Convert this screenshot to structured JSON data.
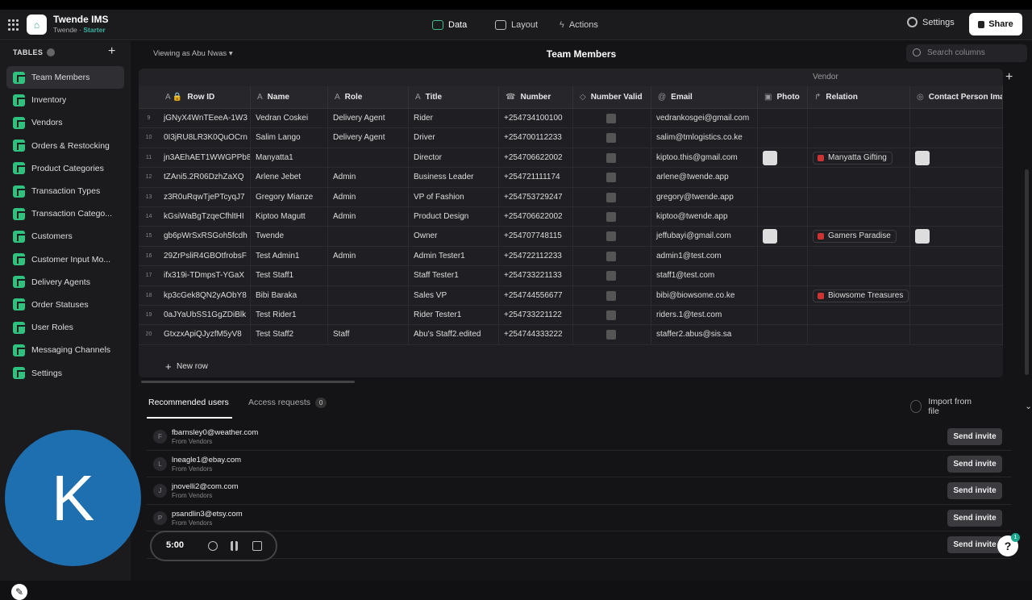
{
  "app": {
    "title": "Twende IMS",
    "workspace": "Twende",
    "plan": "Starter"
  },
  "nav": {
    "data": "Data",
    "layout": "Layout",
    "actions": "Actions",
    "settings": "Settings",
    "share": "Share"
  },
  "sidebar": {
    "header": "TABLES",
    "items": [
      "Team Members",
      "Inventory",
      "Vendors",
      "Orders & Restocking",
      "Product Categories",
      "Transaction Types",
      "Transaction Catego...",
      "Customers",
      "Customer Input Mo...",
      "Delivery Agents",
      "Order Statuses",
      "User Roles",
      "Messaging Channels",
      "Settings"
    ]
  },
  "main": {
    "viewing_as": "Viewing as Abu Nwas",
    "title": "Team Members",
    "search_placeholder": "Search columns",
    "group_label": "Vendor",
    "columns": [
      "Row ID",
      "Name",
      "Role",
      "Title",
      "Number",
      "Number Valid",
      "Email",
      "Photo",
      "Relation",
      "Contact Person Ima"
    ],
    "rows": [
      {
        "n": "9",
        "id": "jGNyX4WnTEeeA-1W3",
        "name": "Vedran Coskei",
        "role": "Delivery Agent",
        "title": "Rider",
        "number": "+254734100100",
        "email": "vedrankosgei@gmail.com",
        "photo": false,
        "relation": "",
        "contact": false
      },
      {
        "n": "10",
        "id": "0I3jRU8LR3K0QuOCrn",
        "name": "Salim Lango",
        "role": "Delivery Agent",
        "title": "Driver",
        "number": "+254700112233",
        "email": "salim@tmlogistics.co.ke",
        "photo": false,
        "relation": "",
        "contact": false
      },
      {
        "n": "11",
        "id": "jn3AEhAET1WWGPPb8",
        "name": "Manyatta1",
        "role": "",
        "title": "Director",
        "number": "+254706622002",
        "email": "kiptoo.this@gmail.com",
        "photo": true,
        "relation": "Manyatta Gifting",
        "contact": true
      },
      {
        "n": "12",
        "id": "tZAni5.2R06DzhZaXQ",
        "name": "Arlene Jebet",
        "role": "Admin",
        "title": "Business Leader",
        "number": "+254721111174",
        "email": "arlene@twende.app",
        "photo": false,
        "relation": "",
        "contact": false
      },
      {
        "n": "13",
        "id": "z3R0uRqwTjePTcyqJ7",
        "name": "Gregory Mianze",
        "role": "Admin",
        "title": "VP of Fashion",
        "number": "+254753729247",
        "email": "gregory@twende.app",
        "photo": false,
        "relation": "",
        "contact": false
      },
      {
        "n": "14",
        "id": "kGsiWaBgTzqeCfhltHI",
        "name": "Kiptoo Magutt",
        "role": "Admin",
        "title": "Product Design",
        "number": "+254706622002",
        "email": "kiptoo@twende.app",
        "photo": false,
        "relation": "",
        "contact": false
      },
      {
        "n": "15",
        "id": "gb6pWrSxRSGoh5fcdh",
        "name": "Twende",
        "role": "",
        "title": "Owner",
        "number": "+254707748115",
        "email": "jeffubayi@gmail.com",
        "photo": true,
        "relation": "Gamers Paradise",
        "contact": true
      },
      {
        "n": "16",
        "id": "29ZrPsliR4GBOtfrobsF",
        "name": "Test Admin1",
        "role": "Admin",
        "title": "Admin Tester1",
        "number": "+254722112233",
        "email": "admin1@test.com",
        "photo": false,
        "relation": "",
        "contact": false
      },
      {
        "n": "17",
        "id": "ifx319i-TDmpsT-YGaX",
        "name": "Test Staff1",
        "role": "",
        "title": "Staff Tester1",
        "number": "+254733221133",
        "email": "staff1@test.com",
        "photo": false,
        "relation": "",
        "contact": false
      },
      {
        "n": "18",
        "id": "kp3cGek8QN2yAObY8",
        "name": "Bibi Baraka",
        "role": "",
        "title": "Sales VP",
        "number": "+254744556677",
        "email": "bibi@biowsome.co.ke",
        "photo": false,
        "relation": "Biowsome Treasures",
        "contact": false
      },
      {
        "n": "19",
        "id": "0aJYaUbSS1GgZDiBlk",
        "name": "Test Rider1",
        "role": "",
        "title": "Rider Tester1",
        "number": "+254733221122",
        "email": "riders.1@test.com",
        "photo": false,
        "relation": "",
        "contact": false
      },
      {
        "n": "20",
        "id": "GtxzxApiQJyzfM5yV8",
        "name": "Test Staff2",
        "role": "Staff",
        "title": "Abu's Staff2.edited",
        "number": "+254744333222",
        "email": "staffer2.abus@sis.sa",
        "photo": false,
        "relation": "",
        "contact": false
      }
    ],
    "new_row": "New row"
  },
  "bottom": {
    "tab_recommended": "Recommended users",
    "tab_access": "Access requests",
    "access_count": "0",
    "import": "Import from file",
    "invite_label": "Send invite",
    "users": [
      {
        "initial": "F",
        "email": "fbarnsley0@weather.com",
        "from": "From Vendors"
      },
      {
        "initial": "L",
        "email": "lneagle1@ebay.com",
        "from": "From Vendors"
      },
      {
        "initial": "J",
        "email": "jnovelli2@com.com",
        "from": "From Vendors"
      },
      {
        "initial": "P",
        "email": "psandlin3@etsy.com",
        "from": "From Vendors"
      },
      {
        "initial": "",
        "email": "",
        "from": ""
      }
    ]
  },
  "overlay": {
    "avatar_letter": "K",
    "timer": "5:00",
    "help": "?",
    "help_badge": "1"
  }
}
